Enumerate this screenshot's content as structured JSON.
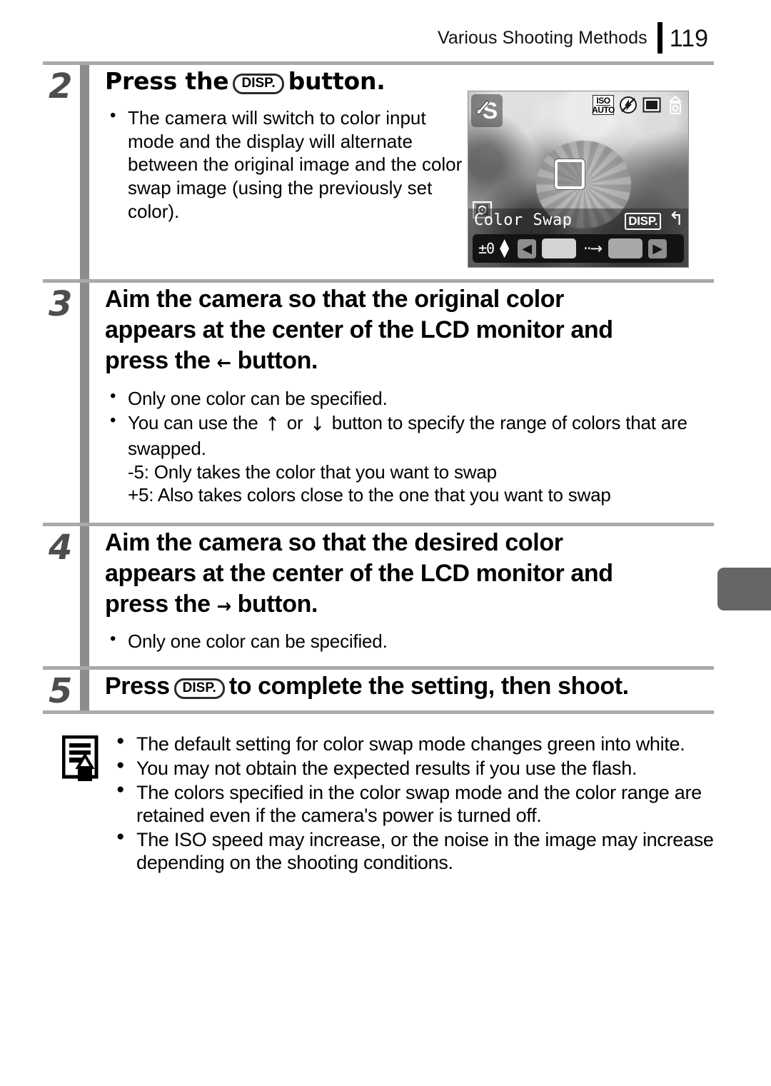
{
  "header": {
    "title": "Various Shooting Methods",
    "page_number": "119"
  },
  "steps": [
    {
      "number": "2",
      "title_prefix": "Press the",
      "button_label": "DISP.",
      "title_suffix": "button.",
      "bullets": [
        "The camera will switch to color input mode and the display will alternate between the original image and the color swap image (using the previously set color)."
      ]
    },
    {
      "number": "3",
      "title_line1": "Aim the camera so that the original color",
      "title_line2": "appears at the center of the LCD monitor and",
      "title_line3_prefix": "press the",
      "title_arrow": "←",
      "title_line3_suffix": "button.",
      "bullets": [
        "Only one color can be specified."
      ],
      "bullet2_prefix": "You can use the",
      "bullet2_arrow_up": "↑",
      "bullet2_mid": "or",
      "bullet2_arrow_down": "↓",
      "bullet2_suffix": "button to specify the range of colors that are swapped.",
      "sub_lines": [
        "-5: Only takes the color that you want to swap",
        "+5: Also takes colors close to the one that you want to swap"
      ]
    },
    {
      "number": "4",
      "title_line1": "Aim the camera so that the desired color",
      "title_line2": "appears at the center of the LCD monitor and",
      "title_line3_prefix": "press the",
      "title_arrow": "→",
      "title_line3_suffix": "button.",
      "bullets": [
        "Only one color can be specified."
      ]
    },
    {
      "number": "5",
      "title_prefix": "Press",
      "button_label": "DISP.",
      "title_suffix": "to complete the setting, then shoot."
    }
  ],
  "lcd": {
    "mode_letter": "S",
    "mode_icon": "eyedropper-icon",
    "status_icons": [
      {
        "name": "iso-auto-icon",
        "line1": "ISO",
        "line2": "AUTO"
      },
      {
        "name": "flash-off-icon"
      },
      {
        "name": "single-shot-icon"
      },
      {
        "name": "macro-icon"
      }
    ],
    "af_frame_icon": "metering-frame-icon",
    "mode_label": "Color Swap",
    "disp_tag": "DISP.",
    "return_glyph": "↰",
    "ev_value": "±0",
    "updown_glyph": "▲▼",
    "left_arrow": "◀",
    "right_arrow": "▶",
    "transform_arrow": "··→",
    "swatch_from": "#d3d3d3",
    "swatch_to": "#a8a8a8"
  },
  "note": {
    "icon": "note-pencil-icon",
    "items": [
      "The default setting for color swap mode changes green into white.",
      "You may not obtain the expected results if you use the flash.",
      "The colors specified in the color swap mode and the color range are retained even if the camera's power is turned off.",
      "The ISO speed may increase, or the noise in the image may increase depending on the shooting conditions."
    ]
  },
  "colors": {
    "step_bar": "#8c8c8c",
    "step_number": "#4d4d4d",
    "rule": "#a9a9a9",
    "side_tab": "#666666"
  }
}
